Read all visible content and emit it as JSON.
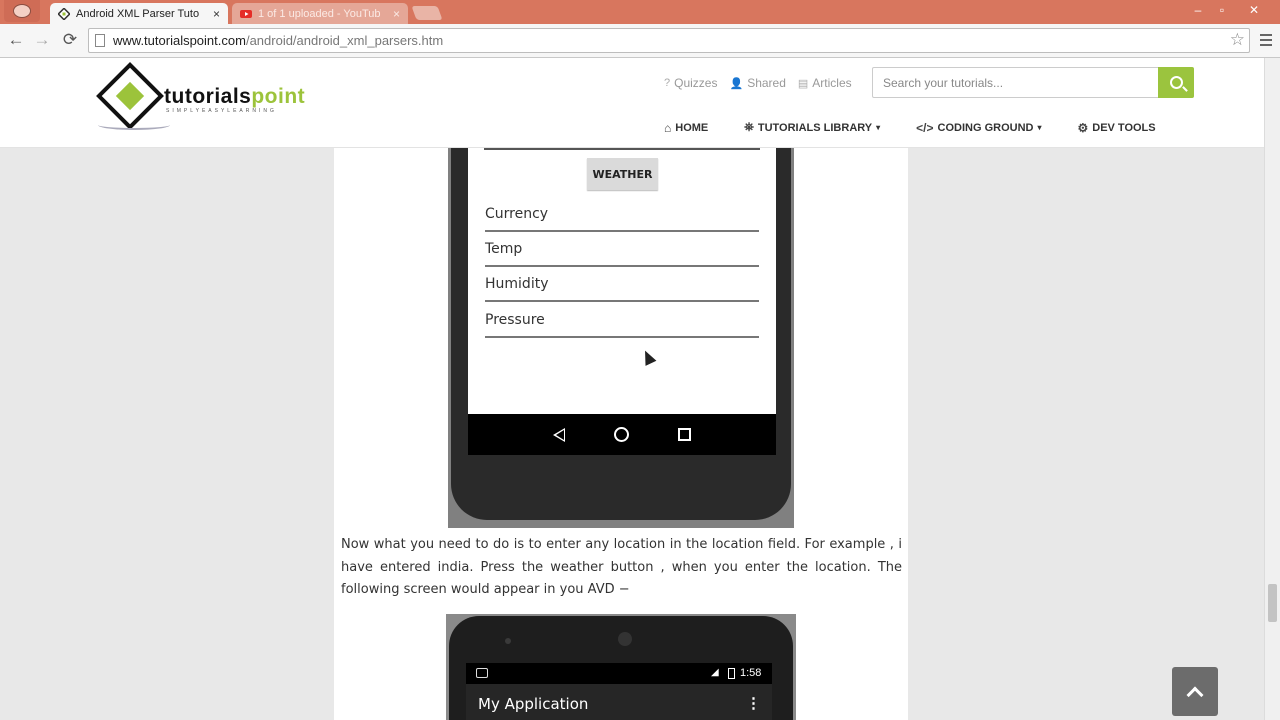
{
  "browser": {
    "tabs": [
      {
        "title": "Android XML Parser Tuto",
        "close": "×"
      },
      {
        "title": "1 of 1 uploaded - YouTub",
        "close": "×"
      }
    ],
    "url_host": "www.tutorialspoint.com",
    "url_path": "/android/android_xml_parsers.htm",
    "window_controls": {
      "minimize": "‒",
      "restore": "▫",
      "close": "✕"
    },
    "nav": {
      "back": "←",
      "forward": "→",
      "reload": "⟳",
      "star": "☆"
    }
  },
  "site": {
    "logo_text": "tutorials",
    "logo_text_accent": "point",
    "logo_tagline": "SIMPLYEASYLEARNING",
    "top_links": [
      {
        "icon": "?",
        "label": "Quizzes"
      },
      {
        "icon": "👤",
        "label": "Shared"
      },
      {
        "icon": "▤",
        "label": "Articles"
      }
    ],
    "search_placeholder": "Search your tutorials...",
    "nav": [
      {
        "icon": "⌂",
        "label": "HOME",
        "caret": ""
      },
      {
        "icon": "⛯",
        "label": "TUTORIALS LIBRARY",
        "caret": "▾"
      },
      {
        "icon": "</>",
        "label": "CODING GROUND",
        "caret": "▾"
      },
      {
        "icon": "⚙",
        "label": "DEV TOOLS",
        "caret": ""
      }
    ],
    "accent_color": "#9bc43e"
  },
  "phone1": {
    "button_label": "WEATHER",
    "fields": [
      "Currency",
      "Temp",
      "Humidity",
      "Pressure"
    ]
  },
  "article": {
    "paragraph": "Now what you need to do is to enter any location in the location field. For example , i have entered india. Press the weather button , when you enter the location. The following screen would appear in you AVD −"
  },
  "phone2": {
    "time": "1:58",
    "app_title": "My Application",
    "overflow": "⋮"
  }
}
